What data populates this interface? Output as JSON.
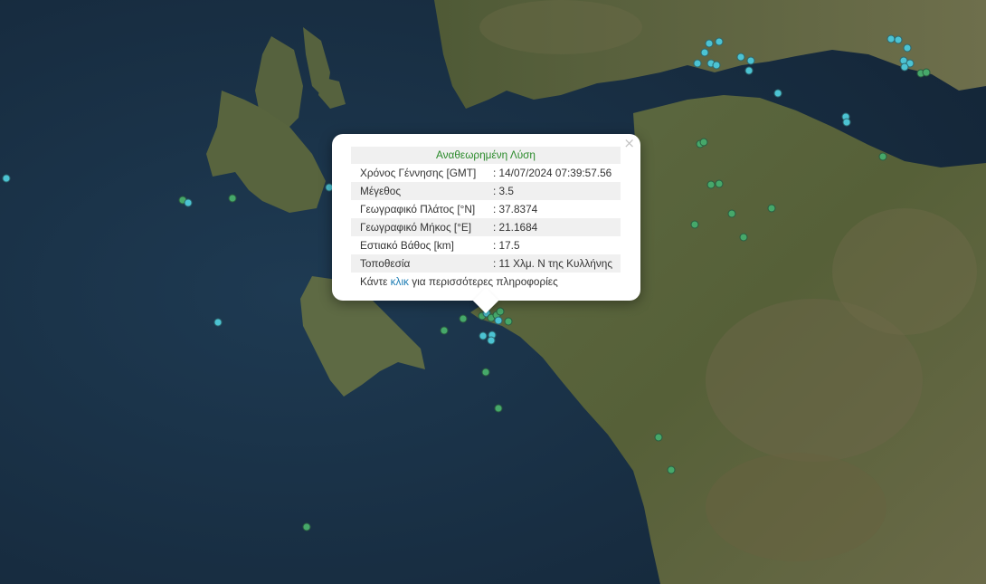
{
  "popup": {
    "title": "Αναθεωρημένη Λύση",
    "close_label": "×",
    "rows": [
      {
        "key": "Χρόνος Γέννησης [GMT]",
        "value": ": 14/07/2024 07:39:57.56"
      },
      {
        "key": "Μέγεθος",
        "value": ": 3.5"
      },
      {
        "key": "Γεωγραφικό Πλάτος [°N]",
        "value": ": 37.8374"
      },
      {
        "key": "Γεωγραφικό Μήκος [°E]",
        "value": ": 21.1684"
      },
      {
        "key": "Εστιακό Βάθος [km]",
        "value": ": 17.5"
      },
      {
        "key": "Τοποθεσία",
        "value": ": 11 Χλμ. Ν της Κυλλήνης"
      }
    ],
    "more_prefix": "Κάντε ",
    "more_link": "κλικ",
    "more_suffix": " για περισσότερες πληροφορίες"
  },
  "colors": {
    "sea": "#1a3046",
    "land": "#4f5a3a",
    "marker_cyan": "#4cc3d3",
    "marker_green": "#46a86a",
    "popup_title": "#2a8a2a",
    "link": "#1f7eb5"
  }
}
